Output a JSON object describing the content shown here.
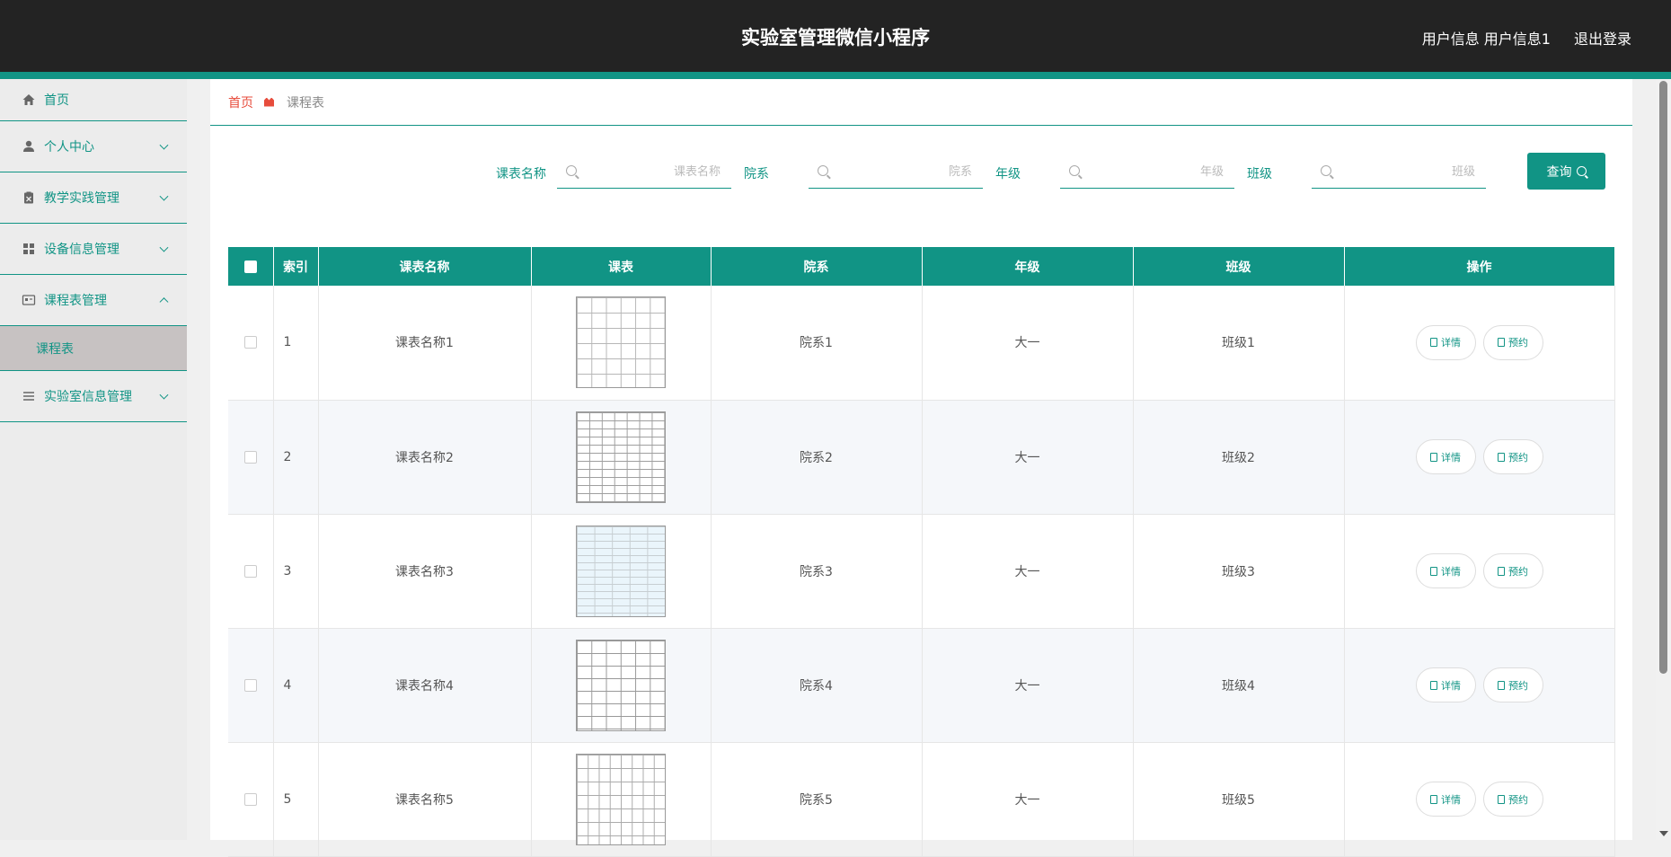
{
  "header": {
    "title": "实验室管理微信小程序",
    "user_info": "用户信息 用户信息1",
    "logout": "退出登录"
  },
  "sidebar": {
    "items": [
      {
        "label": "首页",
        "icon": "home-icon"
      },
      {
        "label": "个人中心",
        "icon": "user-icon"
      },
      {
        "label": "教学实践管理",
        "icon": "clipboard-icon"
      },
      {
        "label": "设备信息管理",
        "icon": "grid-icon"
      },
      {
        "label": "课程表管理",
        "icon": "card-icon"
      },
      {
        "label": "课程表",
        "icon": ""
      },
      {
        "label": "实验室信息管理",
        "icon": "list-icon"
      }
    ]
  },
  "breadcrumb": {
    "home": "首页",
    "current": "课程表"
  },
  "search": {
    "fields": [
      {
        "label": "课表名称",
        "placeholder": "课表名称"
      },
      {
        "label": "院系",
        "placeholder": "院系"
      },
      {
        "label": "年级",
        "placeholder": "年级"
      },
      {
        "label": "班级",
        "placeholder": "班级"
      }
    ],
    "button": "查询"
  },
  "table": {
    "headers": [
      "索引",
      "课表名称",
      "课表",
      "院系",
      "年级",
      "班级",
      "操作"
    ],
    "rows": [
      {
        "index": "1",
        "name": "课表名称1",
        "dept": "院系1",
        "grade": "大一",
        "cls": "班级1"
      },
      {
        "index": "2",
        "name": "课表名称2",
        "dept": "院系2",
        "grade": "大一",
        "cls": "班级2"
      },
      {
        "index": "3",
        "name": "课表名称3",
        "dept": "院系3",
        "grade": "大一",
        "cls": "班级3"
      },
      {
        "index": "4",
        "name": "课表名称4",
        "dept": "院系4",
        "grade": "大一",
        "cls": "班级4"
      },
      {
        "index": "5",
        "name": "课表名称5",
        "dept": "院系5",
        "grade": "大一",
        "cls": "班级5"
      }
    ],
    "actions": {
      "detail": "详情",
      "reserve": "预约"
    }
  },
  "colors": {
    "accent": "#119485",
    "header_bg": "#232323",
    "breadcrumb_home": "#e74c3c"
  }
}
